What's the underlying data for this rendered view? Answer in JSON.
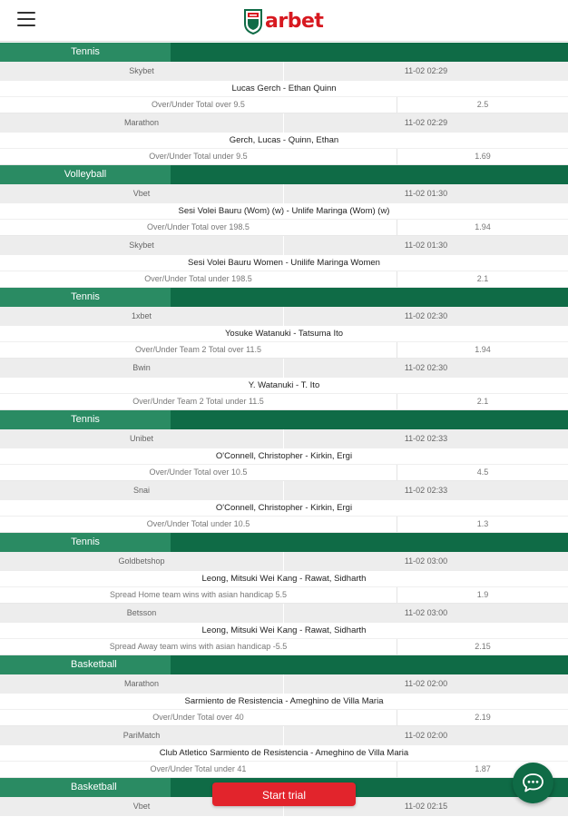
{
  "header": {
    "menu_icon": "hamburger-icon",
    "logo_text": "arbet",
    "logo_icon": "shield-logo-icon"
  },
  "colors": {
    "brand_green": "#0f6b46",
    "label_green": "#2a8b63",
    "trial_red": "#e2242c",
    "logo_red": "#d71920"
  },
  "groups": [
    {
      "sport": "Tennis",
      "bets": [
        {
          "bookmaker": "Skybet",
          "time": "11-02 02:29",
          "match": "Lucas Gerch - Ethan Quinn",
          "market": "Over/Under Total over 9.5",
          "odds": "2.5"
        },
        {
          "bookmaker": "Marathon",
          "time": "11-02 02:29",
          "match": "Gerch, Lucas - Quinn, Ethan",
          "market": "Over/Under Total under 9.5",
          "odds": "1.69"
        }
      ]
    },
    {
      "sport": "Volleyball",
      "bets": [
        {
          "bookmaker": "Vbet",
          "time": "11-02 01:30",
          "match": "Sesi Volei Bauru (Wom) (w) - Unlife Maringa (Wom) (w)",
          "market": "Over/Under Total over 198.5",
          "odds": "1.94"
        },
        {
          "bookmaker": "Skybet",
          "time": "11-02 01:30",
          "match": "Sesi Volei Bauru Women - Unilife Maringa Women",
          "market": "Over/Under Total under 198.5",
          "odds": "2.1"
        }
      ]
    },
    {
      "sport": "Tennis",
      "bets": [
        {
          "bookmaker": "1xbet",
          "time": "11-02 02:30",
          "match": "Yosuke Watanuki - Tatsuma Ito",
          "market": "Over/Under Team 2 Total over 11.5",
          "odds": "1.94"
        },
        {
          "bookmaker": "Bwin",
          "time": "11-02 02:30",
          "match": "Y. Watanuki - T. Ito",
          "market": "Over/Under Team 2 Total under 11.5",
          "odds": "2.1"
        }
      ]
    },
    {
      "sport": "Tennis",
      "bets": [
        {
          "bookmaker": "Unibet",
          "time": "11-02 02:33",
          "match": "O'Connell, Christopher - Kirkin, Ergi",
          "market": "Over/Under Total over 10.5",
          "odds": "4.5"
        },
        {
          "bookmaker": "Snai",
          "time": "11-02 02:33",
          "match": "O'Connell, Christopher - Kirkin, Ergi",
          "market": "Over/Under Total under 10.5",
          "odds": "1.3"
        }
      ]
    },
    {
      "sport": "Tennis",
      "bets": [
        {
          "bookmaker": "Goldbetshop",
          "time": "11-02 03:00",
          "match": "Leong, Mitsuki Wei Kang - Rawat, Sidharth",
          "market": "Spread Home team wins with asian handicap 5.5",
          "odds": "1.9"
        },
        {
          "bookmaker": "Betsson",
          "time": "11-02 03:00",
          "match": "Leong, Mitsuki Wei Kang - Rawat, Sidharth",
          "market": "Spread Away team wins with asian handicap -5.5",
          "odds": "2.15"
        }
      ]
    },
    {
      "sport": "Basketball",
      "bets": [
        {
          "bookmaker": "Marathon",
          "time": "11-02 02:00",
          "match": "Sarmiento de Resistencia - Ameghino de Villa Maria",
          "market": "Over/Under Total over 40",
          "odds": "2.19"
        },
        {
          "bookmaker": "PariMatch",
          "time": "11-02 02:00",
          "match": "Club Atletico Sarmiento de Resistencia - Ameghino de Villa Maria",
          "market": "Over/Under Total under 41",
          "odds": "1.87"
        }
      ]
    },
    {
      "sport": "Basketball",
      "bets": [
        {
          "bookmaker": "Vbet",
          "time": "11-02 02:15",
          "match": "",
          "market": "",
          "odds": ""
        }
      ]
    }
  ],
  "cta": {
    "label": "Start trial"
  },
  "chat": {
    "icon": "chat-bubble-icon"
  }
}
